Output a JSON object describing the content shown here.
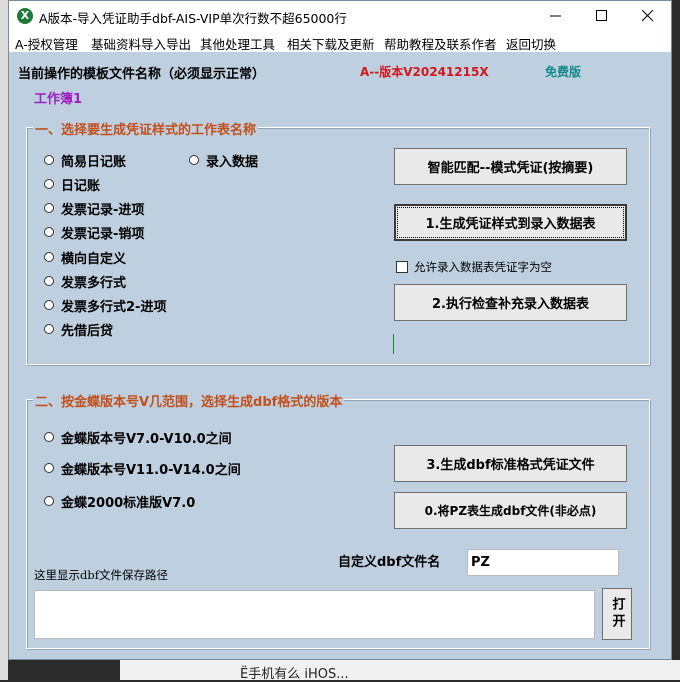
{
  "window": {
    "title": "A版本-导入凭证助手dbf-AIS-VIP单次行数不超65000行",
    "app_icon": "X"
  },
  "menu": [
    "A-授权管理",
    "基础资料导入导出",
    "其他处理工具",
    "相关下载及更新",
    "帮助教程及联系作者",
    "返回切换"
  ],
  "header": {
    "template_label": "当前操作的模板文件名称（必须显示正常）",
    "version": "A--版本V20241215X",
    "edition": "免费版",
    "workbook": "工作簿1"
  },
  "section1": {
    "title": "一、选择要生成凭证样式的工作表名称",
    "options_col1": [
      "简易日记账",
      "日记账",
      "发票记录-进项",
      "发票记录-销项",
      "横向自定义",
      "发票多行式",
      "发票多行式2-进项",
      "先借后贷"
    ],
    "options_col2": [
      "录入数据"
    ],
    "smart_button": "智能匹配--模式凭证(按摘要)",
    "generate_button": "1.生成凭证样式到录入数据表",
    "allow_empty_checkbox": "允许录入数据表凭证字为空",
    "check_button": "2.执行检查补充录入数据表"
  },
  "section2": {
    "title": "二、按金蝶版本号V几范围，选择生成dbf格式的版本",
    "options": [
      "金蝶版本号V7.0-V10.0之间",
      "金蝶版本号V11.0-V14.0之间",
      "金蝶2000标准版V7.0"
    ],
    "dbf_button": "3.生成dbf标准格式凭证文件",
    "pz_button": "0.将PZ表生成dbf文件(非必点)",
    "custom_name_label": "自定义dbf文件名",
    "custom_name_value": "PZ",
    "path_label": "这里显示dbf文件保存路径",
    "path_value": "",
    "open_button": "打开"
  },
  "background": {
    "taskbar_text": "Ё手机有么 iHOS..."
  }
}
